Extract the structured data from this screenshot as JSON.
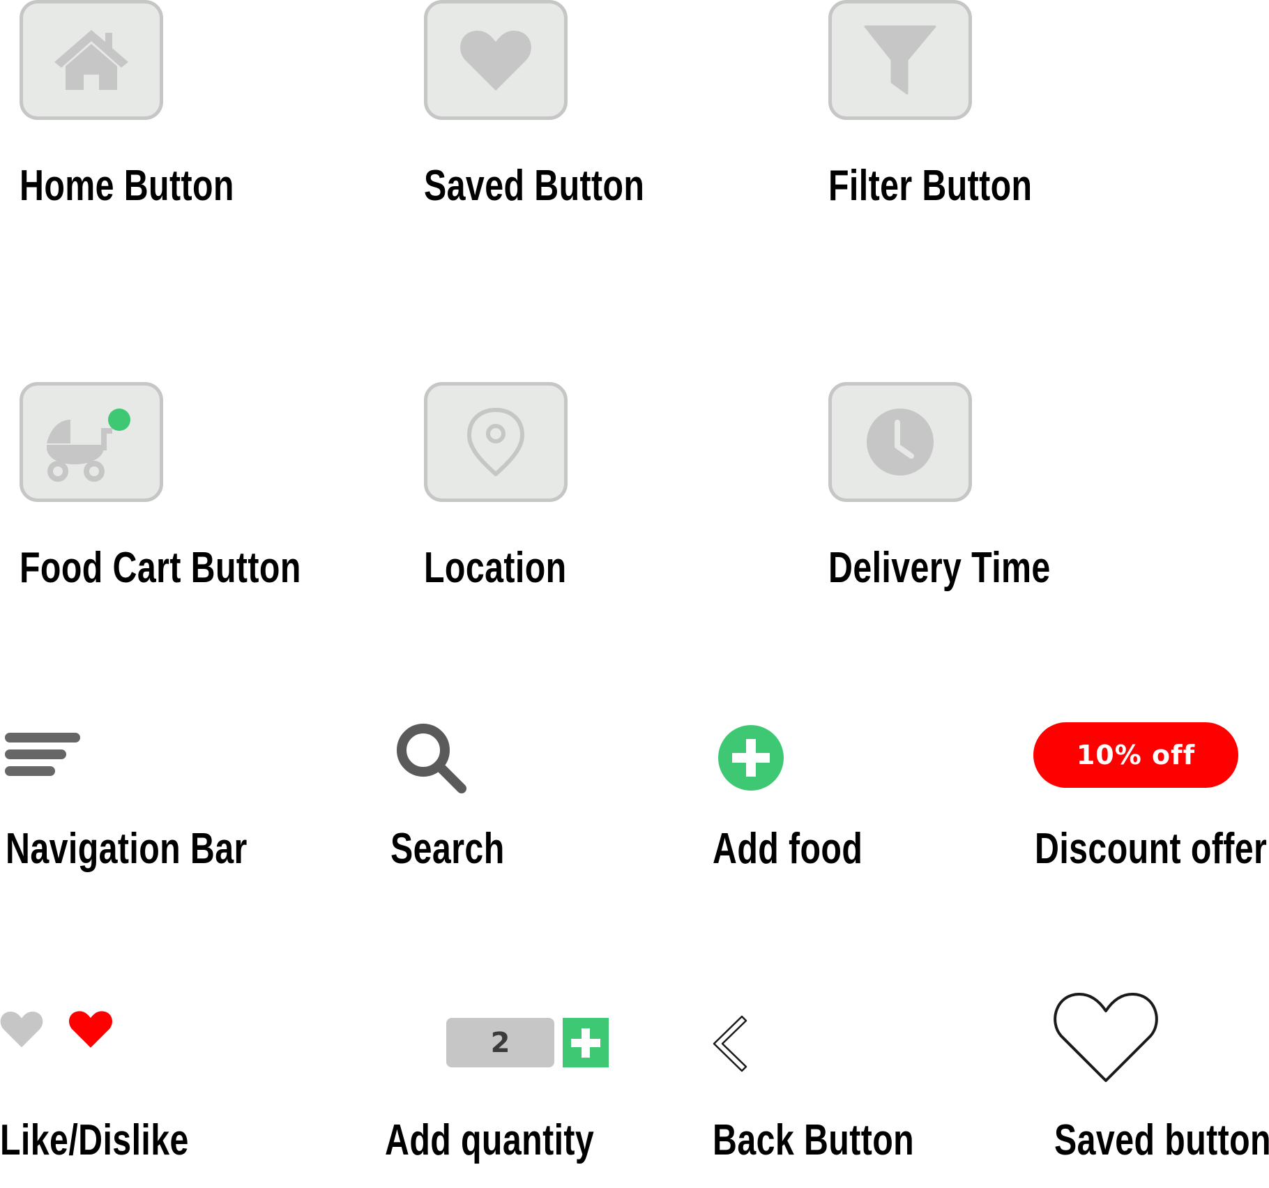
{
  "labels": {
    "home": "Home Button",
    "saved": "Saved Button",
    "filter": "Filter Button",
    "food_cart": "Food Cart Button",
    "location": "Location",
    "delivery_time": "Delivery Time",
    "navigation_bar": "Navigation Bar",
    "search": "Search",
    "add_food": "Add food",
    "discount_offer": "Discount offer",
    "like_dislike": "Like/Dislike",
    "add_quantity": "Add quantity",
    "back": "Back Button",
    "saved_outline": "Saved button"
  },
  "discount_badge": {
    "text": "10% off"
  },
  "quantity": {
    "value": "2"
  },
  "icons": {
    "home": "home-icon",
    "saved": "heart-icon",
    "filter": "funnel-icon",
    "food_cart": "stroller-cart-icon",
    "location": "map-pin-icon",
    "delivery_time": "clock-icon",
    "navigation_bar": "menu-lines-icon",
    "search": "magnifier-icon",
    "add_food": "plus-circle-icon",
    "like": "heart-icon",
    "back": "chevron-left-icon",
    "saved_outline": "heart-outline-icon"
  },
  "colors": {
    "icon_gray": "#c6c6c6",
    "tile_bg": "#e6e9e6",
    "dark_gray": "#5a5a5a",
    "green": "#3ec873",
    "red": "#ff0000"
  }
}
